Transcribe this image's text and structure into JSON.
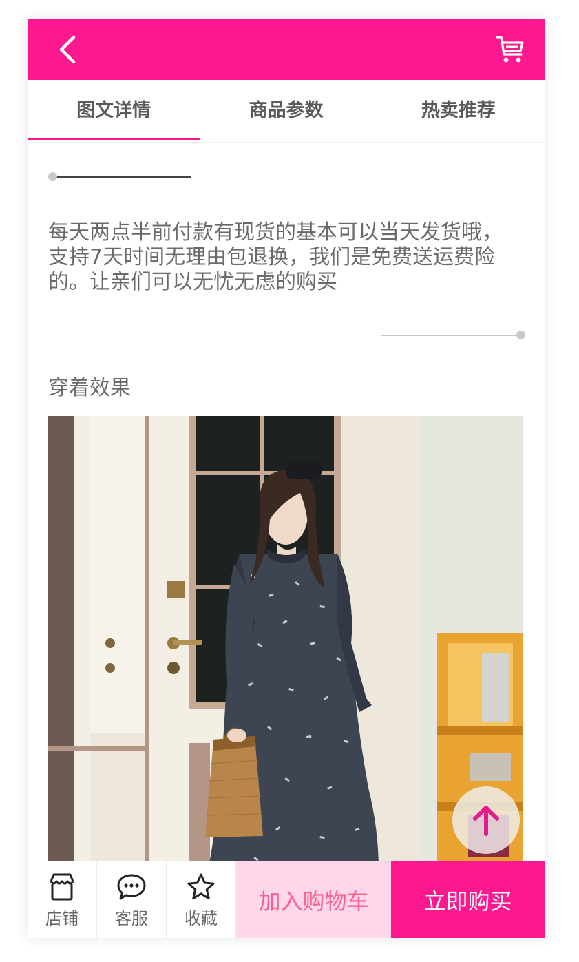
{
  "colors": {
    "accent": "#fe1890",
    "cart_bg": "#ffd7ea",
    "cart_text": "#fe5f8f"
  },
  "header": {
    "back_icon": "chevron-left-icon",
    "cart_icon": "shopping-cart-icon"
  },
  "tabs": [
    {
      "label": "图文详情",
      "active": true
    },
    {
      "label": "商品参数",
      "active": false
    },
    {
      "label": "热卖推荐",
      "active": false
    }
  ],
  "content": {
    "intro": "每天两点半前付款有现货的基本可以当天发货哦，支持7天时间无理由包退换，我们是免费送运费险的。让亲们可以无忧无虑的购买",
    "section_title": "穿着效果"
  },
  "float": {
    "icon": "arrow-up-icon"
  },
  "bottom_bar": {
    "shop": {
      "label": "店铺",
      "icon": "store-icon"
    },
    "service": {
      "label": "客服",
      "icon": "chat-bubble-icon"
    },
    "favorite": {
      "label": "收藏",
      "icon": "star-icon"
    },
    "add_to_cart": "加入购物车",
    "buy_now": "立即购买"
  }
}
